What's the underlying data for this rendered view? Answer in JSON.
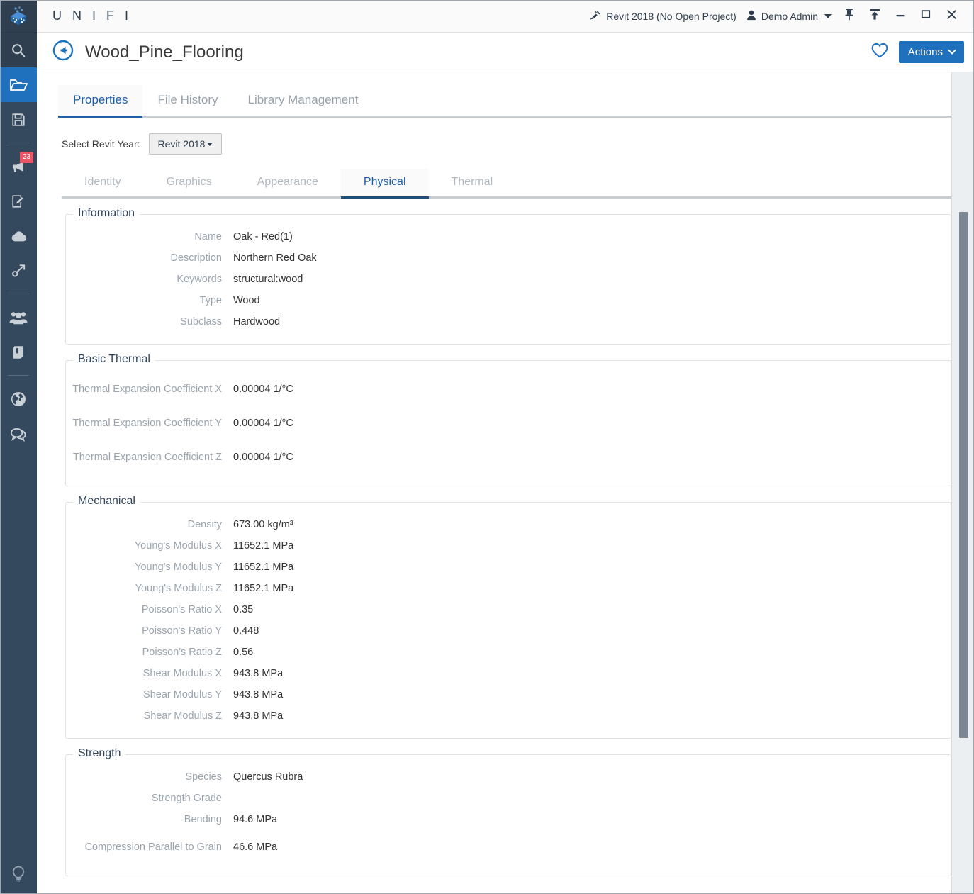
{
  "app": {
    "brand": "U N I F I",
    "logo_icon": "unifi-cube-logo"
  },
  "titlebar": {
    "revit_status": "Revit 2018 (No Open Project)",
    "revit_icon": "plug-icon",
    "user_name": "Demo Admin",
    "user_icon": "user-icon",
    "user_caret_icon": "caret-down-icon",
    "pin_icon": "pin-icon",
    "upload_icon": "upload-icon",
    "minimize_icon": "minimize-icon",
    "maximize_icon": "maximize-icon",
    "close_icon": "close-icon"
  },
  "pagehead": {
    "back_icon": "back-arrow-circle-icon",
    "title": "Wood_Pine_Flooring",
    "favorite_icon": "heart-icon",
    "actions_label": "Actions",
    "actions_caret_icon": "chevron-down-icon"
  },
  "tabs": [
    {
      "label": "Properties",
      "active": true
    },
    {
      "label": "File History",
      "active": false
    },
    {
      "label": "Library Management",
      "active": false
    }
  ],
  "year_selector": {
    "label": "Select Revit Year:",
    "value": "Revit 2018",
    "caret_icon": "caret-down-icon"
  },
  "subtabs": [
    {
      "label": "Identity",
      "active": false
    },
    {
      "label": "Graphics",
      "active": false
    },
    {
      "label": "Appearance",
      "active": false
    },
    {
      "label": "Physical",
      "active": true
    },
    {
      "label": "Thermal",
      "active": false
    }
  ],
  "sections": [
    {
      "legend": "Information",
      "rows": [
        {
          "label": "Name",
          "value": "Oak - Red(1)"
        },
        {
          "label": "Description",
          "value": "Northern Red Oak"
        },
        {
          "label": "Keywords",
          "value": "structural:wood"
        },
        {
          "label": "Type",
          "value": "Wood"
        },
        {
          "label": "Subclass",
          "value": "Hardwood"
        }
      ]
    },
    {
      "legend": "Basic Thermal",
      "rows": [
        {
          "label": "Thermal Expansion Coefficient X",
          "value": "0.00004 1/°C",
          "tall": true
        },
        {
          "label": "Thermal Expansion Coefficient Y",
          "value": "0.00004 1/°C",
          "tall": true
        },
        {
          "label": "Thermal Expansion Coefficient Z",
          "value": "0.00004 1/°C",
          "tall": true
        }
      ]
    },
    {
      "legend": "Mechanical",
      "rows": [
        {
          "label": "Density",
          "value": "673.00 kg/m³"
        },
        {
          "label": "Young's Modulus X",
          "value": "11652.1 MPa"
        },
        {
          "label": "Young's Modulus Y",
          "value": "11652.1 MPa"
        },
        {
          "label": "Young's Modulus Z",
          "value": "11652.1 MPa"
        },
        {
          "label": "Poisson's Ratio X",
          "value": "0.35"
        },
        {
          "label": "Poisson's Ratio Y",
          "value": "0.448"
        },
        {
          "label": "Poisson's Ratio Z",
          "value": "0.56"
        },
        {
          "label": "Shear Modulus X",
          "value": "943.8 MPa"
        },
        {
          "label": "Shear Modulus Y",
          "value": "943.8 MPa"
        },
        {
          "label": "Shear Modulus Z",
          "value": "943.8 MPa"
        }
      ]
    },
    {
      "legend": "Strength",
      "rows": [
        {
          "label": "Species",
          "value": "Quercus Rubra"
        },
        {
          "label": "Strength Grade",
          "value": ""
        },
        {
          "label": "Bending",
          "value": "94.6 MPa"
        },
        {
          "label": "Compression Parallel to Grain",
          "value": "46.6 MPa",
          "tall": true
        }
      ]
    }
  ],
  "sidebar": {
    "items": [
      {
        "name": "search",
        "icon": "search-icon",
        "state": "dark"
      },
      {
        "name": "library",
        "icon": "open-folder-icon",
        "state": "active"
      },
      {
        "name": "saved",
        "icon": "floppy-save-icon",
        "state": "normal"
      },
      {
        "name": "announcements",
        "icon": "megaphone-icon",
        "state": "normal",
        "badge": "23"
      },
      {
        "name": "edit",
        "icon": "pencil-square-icon",
        "state": "normal"
      },
      {
        "name": "upload",
        "icon": "cloud-upload-icon",
        "state": "normal"
      },
      {
        "name": "connect",
        "icon": "node-link-icon",
        "state": "normal"
      },
      {
        "name": "users",
        "icon": "people-icon",
        "state": "normal"
      },
      {
        "name": "catalog",
        "icon": "book-icon",
        "state": "normal"
      },
      {
        "name": "globe",
        "icon": "globe-icon",
        "state": "normal"
      },
      {
        "name": "chat",
        "icon": "speech-bubbles-icon",
        "state": "normal"
      }
    ],
    "bottom": {
      "name": "tips",
      "icon": "lightbulb-icon"
    }
  },
  "scrollbar": {
    "thumb_top_pct": 17,
    "thumb_height_pct": 64
  },
  "colors": {
    "accent": "#1f71bd",
    "rail": "#34495e",
    "badge": "#ed5565",
    "tab_active": "#1f5fa9",
    "label": "#9ba4ad"
  }
}
